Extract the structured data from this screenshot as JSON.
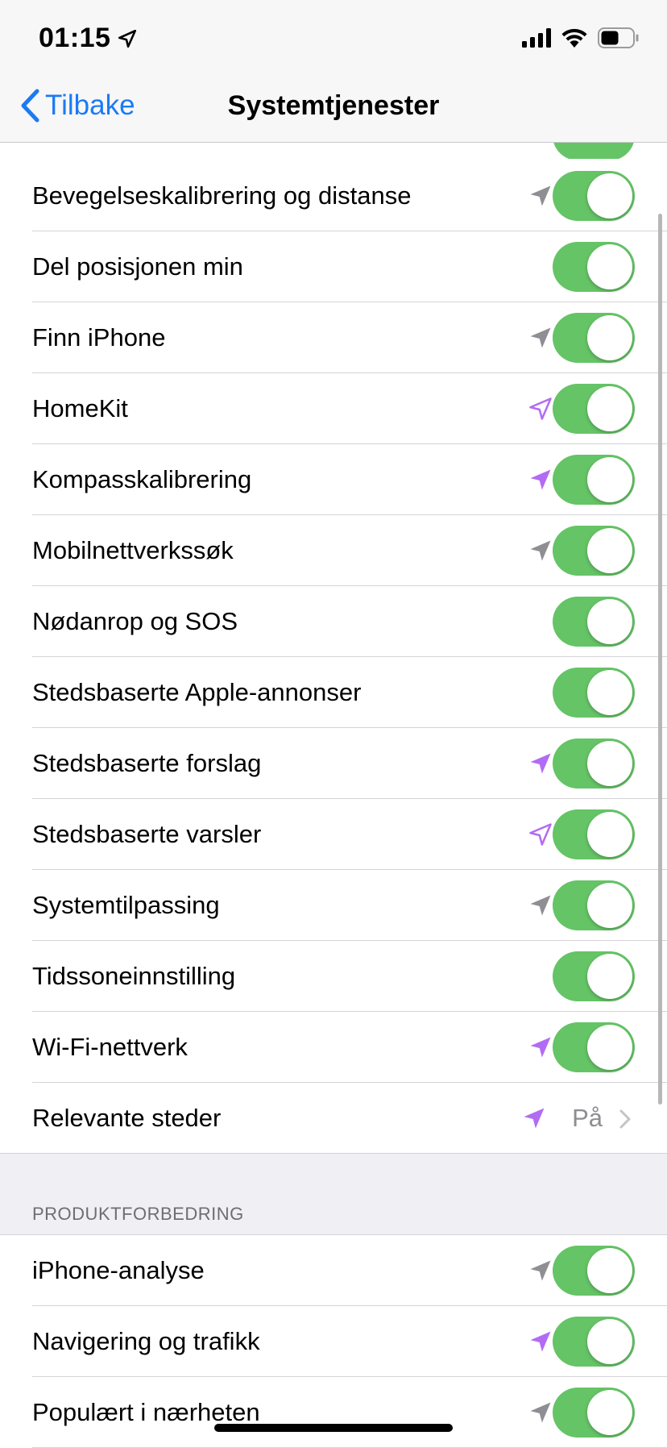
{
  "status_bar": {
    "time": "01:15"
  },
  "nav": {
    "back_label": "Tilbake",
    "title": "Systemtjenester"
  },
  "colors": {
    "accent": "#1a7bf5",
    "toggle_on": "#65c466",
    "arrow_gray": "#8e8e93",
    "arrow_purple": "#b26cf4"
  },
  "rows": [
    {
      "label": "Bevegelseskalibrering og distanse",
      "arrow": "location-arrow-gray",
      "on": true
    },
    {
      "label": "Del posisjonen min",
      "arrow": "none",
      "on": true
    },
    {
      "label": "Finn iPhone",
      "arrow": "location-arrow-gray",
      "on": true
    },
    {
      "label": "HomeKit",
      "arrow": "location-arrow-purple-outline",
      "on": true
    },
    {
      "label": "Kompasskalibrering",
      "arrow": "location-arrow-purple",
      "on": true
    },
    {
      "label": "Mobilnettverkssøk",
      "arrow": "location-arrow-gray",
      "on": true
    },
    {
      "label": "Nødanrop og SOS",
      "arrow": "none",
      "on": true
    },
    {
      "label": "Stedsbaserte Apple-annonser",
      "arrow": "none",
      "on": true
    },
    {
      "label": "Stedsbaserte forslag",
      "arrow": "location-arrow-purple",
      "on": true
    },
    {
      "label": "Stedsbaserte varsler",
      "arrow": "location-arrow-purple-outline",
      "on": true
    },
    {
      "label": "Systemtilpassing",
      "arrow": "location-arrow-gray",
      "on": true
    },
    {
      "label": "Tidssoneinnstilling",
      "arrow": "none",
      "on": true
    },
    {
      "label": "Wi-Fi-nettverk",
      "arrow": "location-arrow-purple",
      "on": true
    }
  ],
  "relevant_places": {
    "label": "Relevante steder",
    "value": "På",
    "arrow": "location-arrow-purple"
  },
  "section_header": "PRODUKTFORBEDRING",
  "rows2": [
    {
      "label": "iPhone-analyse",
      "arrow": "location-arrow-gray",
      "on": true
    },
    {
      "label": "Navigering og trafikk",
      "arrow": "location-arrow-purple",
      "on": true
    },
    {
      "label": "Populært i nærheten",
      "arrow": "location-arrow-gray",
      "on": true
    }
  ]
}
